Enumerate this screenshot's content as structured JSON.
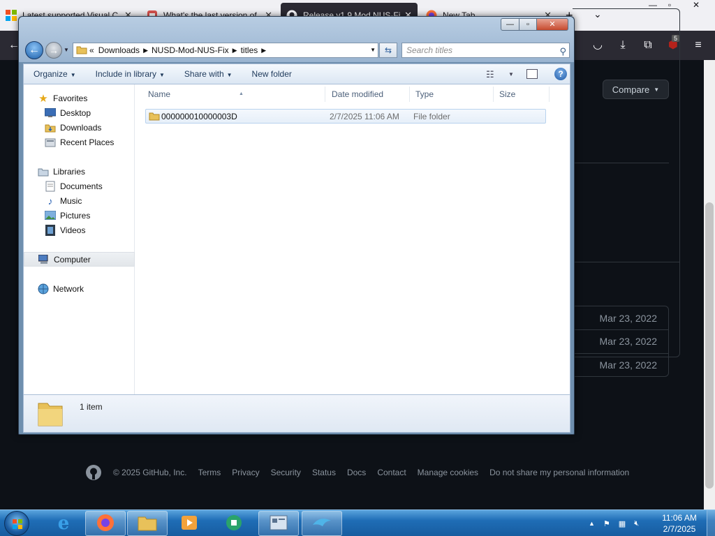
{
  "browser": {
    "tabs": [
      {
        "title": "Latest supported Visual C",
        "active": false
      },
      {
        "title": "What's the last version of",
        "active": false
      },
      {
        "title": "Release v1.9 Mod NUS-Fix",
        "active": true
      },
      {
        "title": "New Tab",
        "active": false
      }
    ],
    "ublock_count": "5"
  },
  "github": {
    "compare_label": "Compare",
    "asset_dates": [
      "Mar 23, 2022",
      "Mar 23, 2022",
      "Mar 23, 2022"
    ],
    "footer": {
      "copyright": "© 2025 GitHub, Inc.",
      "links": [
        "Terms",
        "Privacy",
        "Security",
        "Status",
        "Docs",
        "Contact",
        "Manage cookies",
        "Do not share my personal information"
      ]
    }
  },
  "explorer": {
    "address": {
      "overflow": "«",
      "segments": [
        "Downloads",
        "NUSD-Mod-NUS-Fix",
        "titles"
      ]
    },
    "search_placeholder": "Search titles",
    "commands": {
      "organize": "Organize",
      "include_in_library": "Include in library",
      "share_with": "Share with",
      "new_folder": "New folder"
    },
    "nav": {
      "favorites": "Favorites",
      "desktop": "Desktop",
      "downloads": "Downloads",
      "recent_places": "Recent Places",
      "libraries": "Libraries",
      "documents": "Documents",
      "music": "Music",
      "pictures": "Pictures",
      "videos": "Videos",
      "computer": "Computer",
      "network": "Network"
    },
    "columns": {
      "name": "Name",
      "date_modified": "Date modified",
      "type": "Type",
      "size": "Size"
    },
    "files": [
      {
        "name": "000000010000003D",
        "date_modified": "2/7/2025 11:06 AM",
        "type": "File folder",
        "size": ""
      }
    ],
    "status": "1 item"
  },
  "taskbar": {
    "time": "11:06 AM",
    "date": "2/7/2025"
  },
  "colors": {
    "taskbar": "#1f6db6",
    "explorer_frame": "#9ab4d0",
    "github_bg": "#0d1117",
    "selection": "#e6eff9"
  }
}
